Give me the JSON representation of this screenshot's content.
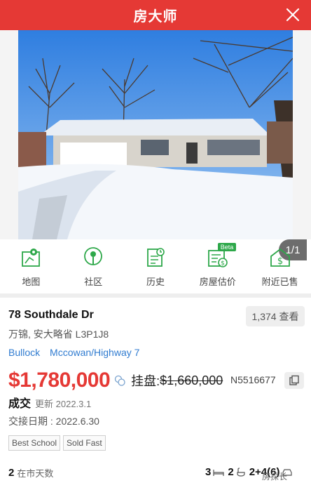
{
  "header": {
    "title": "房大师"
  },
  "gallery": {
    "counter": "1/1"
  },
  "actions": [
    {
      "label": "地图",
      "icon": "map-icon"
    },
    {
      "label": "社区",
      "icon": "community-icon"
    },
    {
      "label": "历史",
      "icon": "history-icon"
    },
    {
      "label": "房屋估价",
      "icon": "valuation-icon",
      "badge": "Beta"
    },
    {
      "label": "附近已售",
      "icon": "nearby-sold-icon"
    }
  ],
  "listing": {
    "address": "78 Southdale Dr",
    "views": "1,374 查看",
    "city": "万锦, 安大略省 L3P1J8",
    "area_links": [
      "Bullock",
      "Mccowan/Highway 7"
    ],
    "sold_price": "$1,780,000",
    "list_label": "挂盘:",
    "list_price": "$1,660,000",
    "mls": "N5516677",
    "status": "成交",
    "updated": "更新 2022.3.1",
    "deal_date": "交接日期 : 2022.6.30",
    "tags": [
      "Best School",
      "Sold Fast"
    ],
    "days_on_market": "2",
    "days_label": "在市天数",
    "beds": "3",
    "baths": "2",
    "parking": "2+4(6)"
  },
  "watermark": "房探长",
  "colors": {
    "brand": "#e53935",
    "link": "#2f7bd0",
    "badge": "#2ea84a"
  }
}
